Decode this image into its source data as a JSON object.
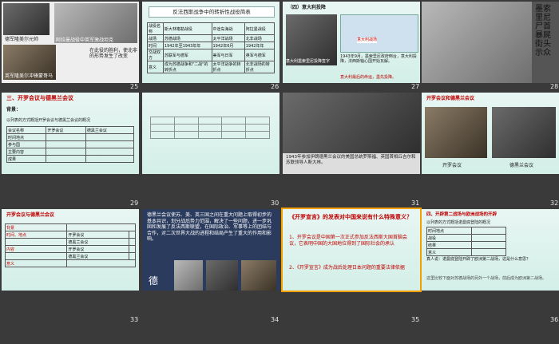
{
  "grid": {
    "slides": [
      {
        "num": "25",
        "caption_top": "德军隆美尔元帅",
        "caption_mid": "阿拉曼战役中英军激战坦克",
        "caption_bot": "英军隆美尔冲锋蒙哥马",
        "caption_side": "在此役的胜利，使北非的形势发生了改变"
      },
      {
        "num": "26",
        "title": "反法西斯战争中的转折性战役简表",
        "table": [
          [
            "战役名称",
            "斯大林格勒战役",
            "中途岛海战",
            "阿拉曼战役"
          ],
          [
            "战场",
            "苏德战场",
            "太平洋战场",
            "北非战场"
          ],
          [
            "时间",
            "1942年至1943年年",
            "1942年6月",
            "1942年年"
          ],
          [
            "交战双方",
            "苏联军与德军",
            "美军与日军",
            "英军与德军"
          ],
          [
            "意义",
            "成为苏德战争和\"二战\"的转折点",
            "太平洋战争的转折点",
            "北非战场的转折点"
          ]
        ]
      },
      {
        "num": "27",
        "heading": "（四）意大利投降",
        "map_label": "意大利战场",
        "photo_caption": "意大利墨索里尼投降签字",
        "text": "1943年9月，墨索里尼政府倒台，意大利投降，法西斯轴心国开始瓦解。",
        "red_text": "意大利最后的命运，墨先投降。"
      },
      {
        "num": "28",
        "side_text": "墨索里尼尸首暴屍街头示众"
      },
      {
        "num": "29",
        "heading": "三、开罗会议与德黑兰会议",
        "sub": "背景：",
        "prompt": "以列表的方式概括开罗会议与德黑兰会议的概况",
        "table": [
          [
            "会议名称",
            "开罗会议",
            "德黑兰会议"
          ],
          [
            "时间地点",
            "",
            ""
          ],
          [
            "参与国",
            "",
            ""
          ],
          [
            "主要内容",
            "",
            ""
          ],
          [
            "成果",
            "",
            ""
          ]
        ]
      },
      {
        "num": "30"
      },
      {
        "num": "31",
        "caption": "1943年参加伊朗德黑兰会议的美国总统罗斯福、英国首相丘吉尔和苏联领导人斯大林。",
        "names": [
          "罗斯福",
          "丘吉尔",
          "斯大林"
        ]
      },
      {
        "num": "32",
        "heading": "开罗会议和德黑兰会议",
        "labels": [
          "开罗会议",
          "德黑兰会议"
        ]
      },
      {
        "num": "33",
        "heading": "开罗会议与德黑兰会议",
        "rows": [
          "背景",
          "时间、地点",
          "内容",
          "意义"
        ],
        "sub": [
          "开罗会议",
          "德黑兰会议",
          "开罗会议",
          "德黑兰会议"
        ]
      },
      {
        "num": "34",
        "text": "德黑兰会议使苏、美、英三国之间在重大问题上取得初步的基本共识，划分战后势力范围，解决了一些问题，进一步巩固和发展了反法西斯联盟，在国际政治、军事等上的团结与合作，对二次世界大战的进程和结局产生了重大的作用和影响。",
        "footer": "德"
      },
      {
        "num": "35",
        "question": "《开罗宣言》的发表对中国来说有什么特殊意义？",
        "point1": "1、开罗会议是中国第一次正式参加反法西斯大国首脑会议，它表明中国的大国地位得到了国际社会的承认",
        "point2": "2、《开罗宣言》成为战后处理日本问题的重要法律依据"
      },
      {
        "num": "36",
        "heading": "四、开辟第二战场与欧洲战场的开辟",
        "prompt": "以列表的方式概括诺曼底登陆的概况",
        "table": [
          [
            "时间地点"
          ],
          [
            "战役"
          ],
          [
            "结果"
          ],
          [
            "意义"
          ]
        ],
        "summary": "真人说：诺曼底登陆开辟了欧洲第二战场，这是什么意思？",
        "footnote": "这里比较下面对苏德战场的另外一个战场，前后成为欧洲第二战场。"
      }
    ]
  },
  "colors": {
    "bg": "#3a3a3a",
    "selected": "#f2a100",
    "accent": "#4aa3a0",
    "red": "#c00000"
  }
}
